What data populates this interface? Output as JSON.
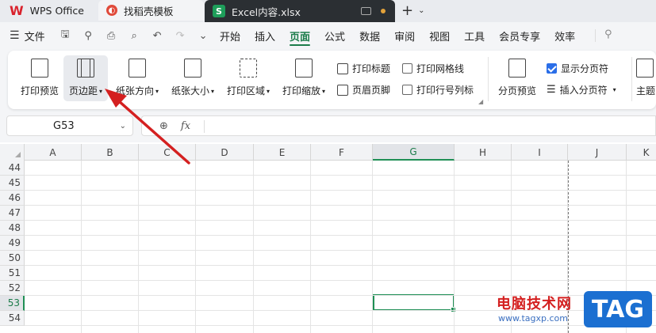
{
  "tabs": {
    "wps": "WPS Office",
    "template": "找稻壳模板",
    "file": "Excel内容.xlsx",
    "file_icon": "S"
  },
  "menubar": {
    "file": "文件",
    "tabs": [
      "开始",
      "插入",
      "页面",
      "公式",
      "数据",
      "审阅",
      "视图",
      "工具",
      "会员专享",
      "效率"
    ],
    "active_tab": "页面"
  },
  "ribbon": {
    "print_preview": "打印预览",
    "page_margin": "页边距",
    "orientation": "纸张方向",
    "paper_size": "纸张大小",
    "print_area": "打印区域",
    "print_scale": "打印缩放",
    "print_titles": "打印标题",
    "header_footer": "页眉页脚",
    "print_gridlines": "打印网格线",
    "print_row_col": "打印行号列标",
    "page_break_preview": "分页预览",
    "show_page_break": "显示分页符",
    "insert_page_break": "插入分页符",
    "theme_partial": "主题"
  },
  "formula_bar": {
    "name_box": "G53",
    "fx": "fx"
  },
  "grid": {
    "columns": [
      "A",
      "B",
      "C",
      "D",
      "E",
      "F",
      "G",
      "H",
      "I",
      "J",
      "K"
    ],
    "rows": [
      "44",
      "45",
      "46",
      "47",
      "48",
      "49",
      "50",
      "51",
      "52",
      "53",
      "54"
    ],
    "selected_col": "G",
    "selected_row": "53"
  },
  "watermark": {
    "title": "电脑技术网",
    "url": "www.tagxp.com",
    "tag": "TAG"
  },
  "colors": {
    "accent_green": "#1f8f55",
    "annotation_red": "#d42020",
    "checkbox_blue": "#2a6ee8"
  }
}
